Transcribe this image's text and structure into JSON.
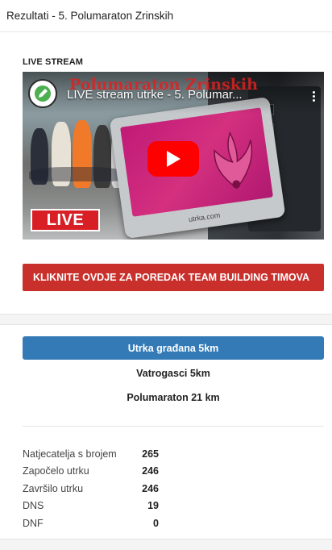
{
  "header": {
    "title": "Rezultati - 5. Polumaraton Zrinskih"
  },
  "live": {
    "heading": "LIVE STREAM",
    "video": {
      "background_title": "Polumaraton Zrinskih",
      "title": "LIVE stream utrke - 5. Polumar...",
      "badge": "LIVE",
      "screen_text": "aton",
      "device_brand": "utrka.com",
      "play_color": "#ff0000"
    }
  },
  "cta": {
    "label": "KLIKNITE OVDJE ZA POREDAK TEAM BUILDING TIMOVA"
  },
  "races": {
    "active": "Utrka građana 5km",
    "items": [
      "Vatrogasci 5km",
      "Polumaraton 21 km"
    ],
    "active_color": "#337ab7"
  },
  "stats": [
    {
      "label": "Natjecatelja s brojem",
      "value": "265"
    },
    {
      "label": "Započelo utrku",
      "value": "246"
    },
    {
      "label": "Završilo utrku",
      "value": "246"
    },
    {
      "label": "DNS",
      "value": "19"
    },
    {
      "label": "DNF",
      "value": "0"
    }
  ],
  "colors": {
    "cta": "#c9302c",
    "live_badge": "#d81f26"
  }
}
